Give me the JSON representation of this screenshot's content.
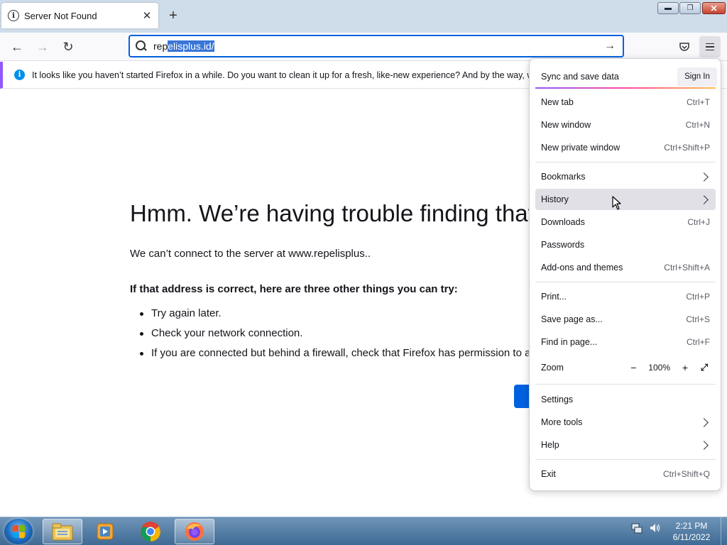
{
  "browser": {
    "tab": {
      "title": "Server Not Found",
      "close_glyph": "✕"
    },
    "new_tab_glyph": "+",
    "window_controls": {
      "minimize": "▬",
      "maximize": "❐",
      "close": "✕"
    }
  },
  "nav": {
    "back": "←",
    "forward": "→",
    "reload": "↻",
    "url_prefix": "rep",
    "url_selected": "elisplus.id/",
    "go": "→"
  },
  "notification": {
    "icon": "i",
    "text": "It looks like you haven’t started Firefox in a while. Do you want to clean it up for a fresh, like-new experience? And by the way, welcome back!"
  },
  "error_page": {
    "title": "Hmm. We’re having trouble finding that site.",
    "description": "We can’t connect to the server at www.repelisplus..",
    "subtitle": "If that address is correct, here are three other things you can try:",
    "suggestions": [
      "Try again later.",
      "Check your network connection.",
      "If you are connected but behind a firewall, check that Firefox has permission to access the Web."
    ]
  },
  "menu": {
    "sync_label": "Sync and save data",
    "sign_in": "Sign In",
    "items": [
      {
        "label": "New tab",
        "shortcut": "Ctrl+T"
      },
      {
        "label": "New window",
        "shortcut": "Ctrl+N"
      },
      {
        "label": "New private window",
        "shortcut": "Ctrl+Shift+P"
      },
      {
        "label": "Bookmarks",
        "shortcut": ""
      },
      {
        "label": "History",
        "shortcut": ""
      },
      {
        "label": "Downloads",
        "shortcut": "Ctrl+J"
      },
      {
        "label": "Passwords",
        "shortcut": ""
      },
      {
        "label": "Add-ons and themes",
        "shortcut": "Ctrl+Shift+A"
      },
      {
        "label": "Print...",
        "shortcut": "Ctrl+P"
      },
      {
        "label": "Save page as...",
        "shortcut": "Ctrl+S"
      },
      {
        "label": "Find in page...",
        "shortcut": "Ctrl+F"
      },
      {
        "label": "Zoom",
        "shortcut": ""
      },
      {
        "label": "Settings",
        "shortcut": ""
      },
      {
        "label": "More tools",
        "shortcut": ""
      },
      {
        "label": "Help",
        "shortcut": ""
      },
      {
        "label": "Exit",
        "shortcut": "Ctrl+Shift+Q"
      }
    ],
    "zoom": {
      "minus": "−",
      "value": "100%",
      "plus": "+",
      "fullscreen": "⤢"
    }
  },
  "taskbar": {
    "clock_time": "2:21 PM",
    "clock_date": "6/11/2022",
    "apps": [
      "explorer-icon",
      "media-player-icon",
      "chrome-icon",
      "firefox-icon"
    ]
  },
  "colors": {
    "accent": "#0061e0",
    "tabbar": "#cfdcea",
    "notification_border": "#9059ff",
    "taskbar": "#3f6a94"
  }
}
